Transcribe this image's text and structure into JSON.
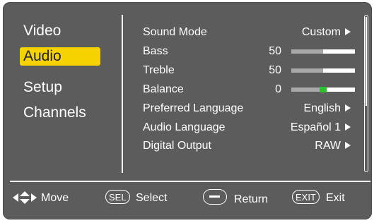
{
  "menu": {
    "items": [
      {
        "label": "Video"
      },
      {
        "label": "Audio"
      },
      {
        "label": "Setup"
      },
      {
        "label": "Channels"
      }
    ],
    "active_index": 1
  },
  "settings": {
    "sound_mode": {
      "label": "Sound Mode",
      "value": "Custom"
    },
    "bass": {
      "label": "Bass",
      "value": "50",
      "level": 0.5
    },
    "treble": {
      "label": "Treble",
      "value": "50",
      "level": 0.5
    },
    "balance": {
      "label": "Balance",
      "value": "0",
      "level": 0.5
    },
    "preferred_language": {
      "label": "Preferred Language",
      "value": "English"
    },
    "audio_language": {
      "label": "Audio Language",
      "value": "Español 1"
    },
    "digital_output": {
      "label": "Digital Output",
      "value": "RAW"
    }
  },
  "footer": {
    "move": "Move",
    "sel_key": "SEL",
    "select": "Select",
    "return": "Return",
    "exit_key": "EXIT",
    "exit": "Exit"
  },
  "colors": {
    "panel": "#5c5c5c",
    "highlight": "#f6d200",
    "balance_knob": "#2fbf2f"
  }
}
